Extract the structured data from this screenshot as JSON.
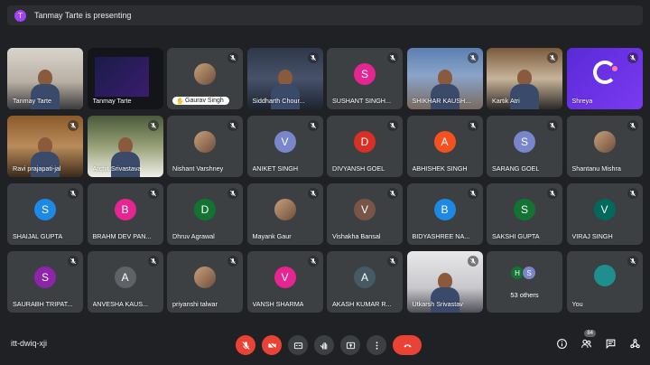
{
  "banner": {
    "avatar_letter": "T",
    "text": "Tanmay Tarte is presenting"
  },
  "participants": [
    {
      "name": "Tanmay Tarte",
      "kind": "video",
      "video": "v1",
      "muted": false,
      "speaking": true
    },
    {
      "name": "Tanmay Tarte",
      "kind": "presentation",
      "video": "v2",
      "muted": false
    },
    {
      "name": "Gaurav Singh",
      "kind": "photo-pill",
      "muted": true
    },
    {
      "name": "Siddharth Chour...",
      "kind": "video",
      "video": "v3",
      "muted": true
    },
    {
      "name": "SUSHANT SINGH...",
      "kind": "letter",
      "letter": "S",
      "color": "#e52592",
      "muted": true
    },
    {
      "name": "SHIKHAR KAUSH...",
      "kind": "video",
      "video": "v4",
      "muted": true
    },
    {
      "name": "Kartik Atri",
      "kind": "video",
      "video": "v5",
      "muted": true
    },
    {
      "name": "Shreya",
      "kind": "shreya",
      "muted": true
    },
    {
      "name": "Ravi prajapati-jal",
      "kind": "video",
      "video": "v6",
      "muted": true
    },
    {
      "name": "Archit Srivastava",
      "kind": "video",
      "video": "v7",
      "muted": true
    },
    {
      "name": "Nishant Varshney",
      "kind": "photo",
      "muted": true
    },
    {
      "name": "ANIKET SINGH",
      "kind": "letter",
      "letter": "V",
      "color": "#7986cb",
      "muted": true
    },
    {
      "name": "DIVYANSH GOEL",
      "kind": "letter",
      "letter": "D",
      "color": "#d93025",
      "muted": true
    },
    {
      "name": "ABHISHEK SINGH",
      "kind": "letter",
      "letter": "A",
      "color": "#f4511e",
      "muted": true
    },
    {
      "name": "SARANG GOEL",
      "kind": "letter",
      "letter": "S",
      "color": "#7986cb",
      "muted": true
    },
    {
      "name": "Shantanu Mishra",
      "kind": "photo",
      "muted": true
    },
    {
      "name": "SHAIJAL GUPTA",
      "kind": "letter",
      "letter": "S",
      "color": "#1e88e5",
      "muted": true
    },
    {
      "name": "BRAHM DEV PAN...",
      "kind": "letter",
      "letter": "B",
      "color": "#e52592",
      "muted": true
    },
    {
      "name": "Dhruv Agrawal",
      "kind": "letter",
      "letter": "D",
      "color": "#137333",
      "muted": true
    },
    {
      "name": "Mayank Gaur",
      "kind": "photo",
      "muted": true
    },
    {
      "name": "Vishakha Bansal",
      "kind": "letter",
      "letter": "V",
      "color": "#795548",
      "muted": true
    },
    {
      "name": "BIDYASHREE NA...",
      "kind": "letter",
      "letter": "B",
      "color": "#1e88e5",
      "muted": true
    },
    {
      "name": "SAKSHI GUPTA",
      "kind": "letter",
      "letter": "S",
      "color": "#137333",
      "muted": true
    },
    {
      "name": "VIRAJ SINGH",
      "kind": "letter",
      "letter": "V",
      "color": "#00695c",
      "muted": true
    },
    {
      "name": "SAURABH TRIPAT...",
      "kind": "letter",
      "letter": "S",
      "color": "#8e24aa",
      "muted": true
    },
    {
      "name": "ANVESHA KAUS...",
      "kind": "letter",
      "letter": "A",
      "color": "#5f6368",
      "muted": true
    },
    {
      "name": "priyanshi talwar",
      "kind": "photo",
      "muted": true
    },
    {
      "name": "VANSH SHARMA",
      "kind": "letter",
      "letter": "V",
      "color": "#e52592",
      "muted": true
    },
    {
      "name": "AKASH KUMAR R...",
      "kind": "letter",
      "letter": "A",
      "color": "#455a64",
      "muted": true
    },
    {
      "name": "Utkarsh Srivastav",
      "kind": "video",
      "video": "v8",
      "muted": true
    },
    {
      "name": "53 others",
      "kind": "others",
      "letters": [
        "H",
        "S"
      ],
      "colors": [
        "#137333",
        "#7986cb"
      ],
      "muted": false
    },
    {
      "name": "You",
      "kind": "you",
      "muted": true
    }
  ],
  "bottom": {
    "meeting_code": "itt-dwiq-xji",
    "people_count": "84"
  },
  "colors": {
    "background": "#202124",
    "tile": "#3c4043",
    "danger": "#ea4335",
    "accent": "#8ab4f8"
  }
}
